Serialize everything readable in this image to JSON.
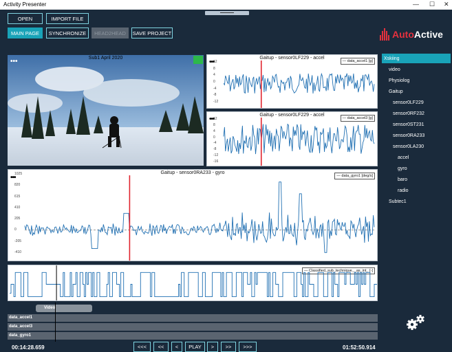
{
  "window": {
    "title": "Activity Presenter",
    "min": "—",
    "max": "☐",
    "close": "✕"
  },
  "toolbar": {
    "open": "OPEN",
    "import_file": "IMPORT FILE",
    "main_page": "MAIN PAGE",
    "synchronize": "SYNCHRONIZE",
    "head2head": "HEAD2HEAD",
    "save_project": "SAVE PROJECT"
  },
  "logo": {
    "brand_a": "Auto",
    "brand_b": "Active"
  },
  "video": {
    "title": "Sub1 April 2020",
    "menu": "•••"
  },
  "plots": [
    {
      "title": "Gaitup - sensor0LF229 - accel",
      "legend": "— data_accel1 [g]",
      "menu": "•••",
      "yticks": [
        "12",
        "8",
        "4",
        "0",
        "-4",
        "-8",
        "-12"
      ]
    },
    {
      "title": "Gaitup - sensor0LF229 - accel",
      "legend": "— data_accel3 [g]",
      "menu": "•••",
      "yticks": [
        "12",
        "8",
        "4",
        "0",
        "-4",
        "-8",
        "-12",
        "-16"
      ]
    },
    {
      "title": "Gaitup - sensor0RA233 - gyro",
      "legend": "— data_gyro1 [deg/s]",
      "menu": "•••",
      "yticks": [
        "1025",
        "820",
        "615",
        "410",
        "205",
        "0",
        "-205",
        "-410"
      ]
    },
    {
      "title": "",
      "legend": "— Classified_sub_technique__as_int_ [-]",
      "menu": ""
    }
  ],
  "tree": [
    {
      "label": "Xskiing",
      "level": 0,
      "selected": true
    },
    {
      "label": "video",
      "level": 1
    },
    {
      "label": "Physiolog",
      "level": 1
    },
    {
      "label": "Gaitup",
      "level": 2
    },
    {
      "label": "sensor0LF229",
      "level": 3
    },
    {
      "label": "sensor0RF232",
      "level": 3
    },
    {
      "label": "sensor0ST231",
      "level": 3
    },
    {
      "label": "sensor0RA233",
      "level": 3
    },
    {
      "label": "sensor0LA230",
      "level": 3
    },
    {
      "label": "accel",
      "level": 4
    },
    {
      "label": "gyro",
      "level": 4
    },
    {
      "label": "baro",
      "level": 4
    },
    {
      "label": "radio",
      "level": 4
    },
    {
      "label": "Subtec1",
      "level": 1
    }
  ],
  "timeline": {
    "video_label": "Video",
    "rows": [
      "data_accel1",
      "data_accel3",
      "data_gyro1"
    ]
  },
  "playback": {
    "start_time": "00:14:28.659",
    "end_time": "01:52:50.914",
    "fast_back": "<<<",
    "back": "<<",
    "step_back": "<",
    "play": "PLAY",
    "step_fwd": ">",
    "fwd": ">>",
    "fast_fwd": ">>>"
  },
  "colors": {
    "accent": "#19a3b8",
    "signal": "#1f6fb2",
    "cursor": "#e0242e",
    "brand": "#e5313e"
  },
  "icons": {
    "settings": "gears-icon"
  }
}
